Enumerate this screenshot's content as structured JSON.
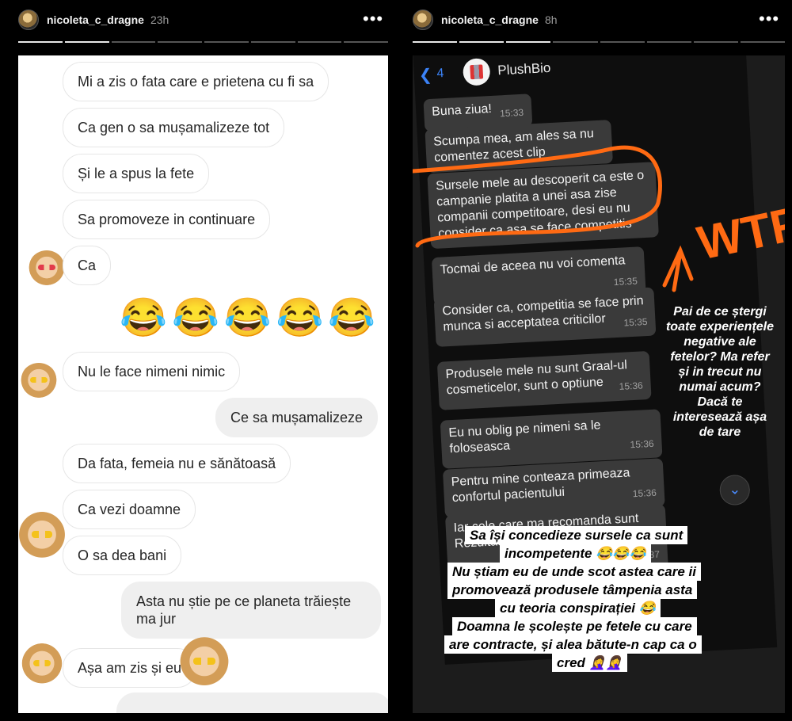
{
  "left_story": {
    "username": "nicoleta_c_dragne",
    "time": "23h",
    "messages": [
      "Mi a zis o fata care e prietena cu fi sa",
      "Ca gen o sa mușamalizeze tot",
      "Și le a spus la fete",
      "Sa promoveze in continuare",
      "Ca",
      "😂😂😂😂😂",
      "Nu le face nimeni nimic",
      "Ce sa mușamalizeze",
      "Da fata, femeia nu e sănătoasă",
      "Ca vezi doamne",
      "O sa dea bani",
      "Asta nu știe pe ce planeta trăiește ma jur",
      "Așa am zis și eu"
    ]
  },
  "right_story": {
    "username": "nicoleta_c_dragne",
    "time": "8h",
    "chat": {
      "back_count": "4",
      "contact_name": "PlushBio",
      "messages": [
        {
          "text": "Buna ziua!",
          "time": "15:33"
        },
        {
          "text": "Scumpa mea, am ales sa nu comentez acest clip",
          "time": ""
        },
        {
          "text": "Sursele mele au descoperit ca este o campanie platita a unei asa zise companii competitoare,  desi eu nu consider ca asa se face competitis",
          "time": ""
        },
        {
          "text": "Tocmai de aceea nu voi comenta",
          "time": "15:35"
        },
        {
          "text": "Consider ca, competitia se face prin munca si acceptatea criticilor",
          "time": "15:35"
        },
        {
          "text": "Produsele mele nu sunt Graal-ul cosmeticelor,  sunt o optiune",
          "time": "15:36"
        },
        {
          "text": "Eu nu oblig pe nimeni sa le foloseasca",
          "time": "15:36"
        },
        {
          "text": "Pentru mine conteaza primeaza confortul pacientului",
          "time": "15:36"
        },
        {
          "text": "Iar cele care ma recomanda sunt Rezultatele pe miile de pacienti",
          "time": "15:37"
        }
      ]
    },
    "annotation_text": "WTF",
    "side_caption": "Pai de ce ștergi toate experiențele negative ale fetelor? Ma refer și in trecut nu numai acum? Dacă te interesează așa de tare",
    "bottom_caption_lines": [
      "Sa își concedieze sursele ca sunt",
      "incompetente 😂😂😂",
      "Nu știam eu de unde scot astea care ii",
      "promovează produsele tâmpenia asta",
      "cu teoria conspirației 😂",
      "Doamna le școlește pe fetele cu care",
      "are contracte, și alea bătute-n cap ca o",
      "cred 🤦‍♀️🤦‍♀️"
    ],
    "accent_color": "#ff6a13"
  }
}
